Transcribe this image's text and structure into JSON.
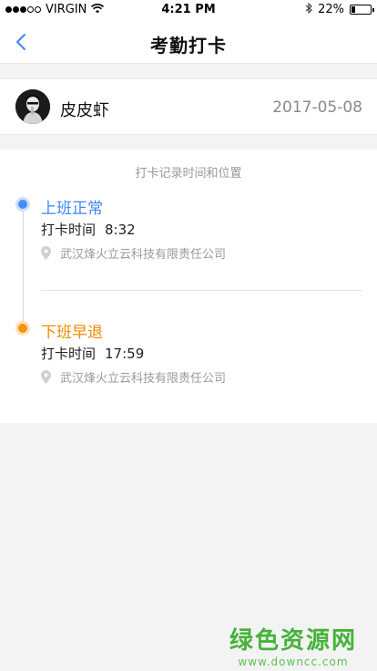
{
  "status_bar": {
    "carrier": "VIRGIN",
    "time": "4:21 PM",
    "battery": "22%",
    "battery_level": 0.22
  },
  "nav": {
    "title": "考勤打卡"
  },
  "user": {
    "name": "皮皮虾",
    "date": "2017-05-08"
  },
  "records": {
    "caption": "打卡记录时间和位置",
    "items": [
      {
        "status": "上班正常",
        "time_label": "打卡时间",
        "time": "8:32",
        "location": "武汉烽火立云科技有限责任公司"
      },
      {
        "status": "下班早退",
        "time_label": "打卡时间",
        "time": "17:59",
        "location": "武汉烽火立云科技有限责任公司"
      }
    ]
  },
  "watermark": {
    "title": "绿色资源网",
    "url": "www.downcc.com"
  },
  "colors": {
    "accent_blue": "#4a8cf7",
    "accent_orange": "#f5930f",
    "watermark_green": "#46b23a"
  }
}
